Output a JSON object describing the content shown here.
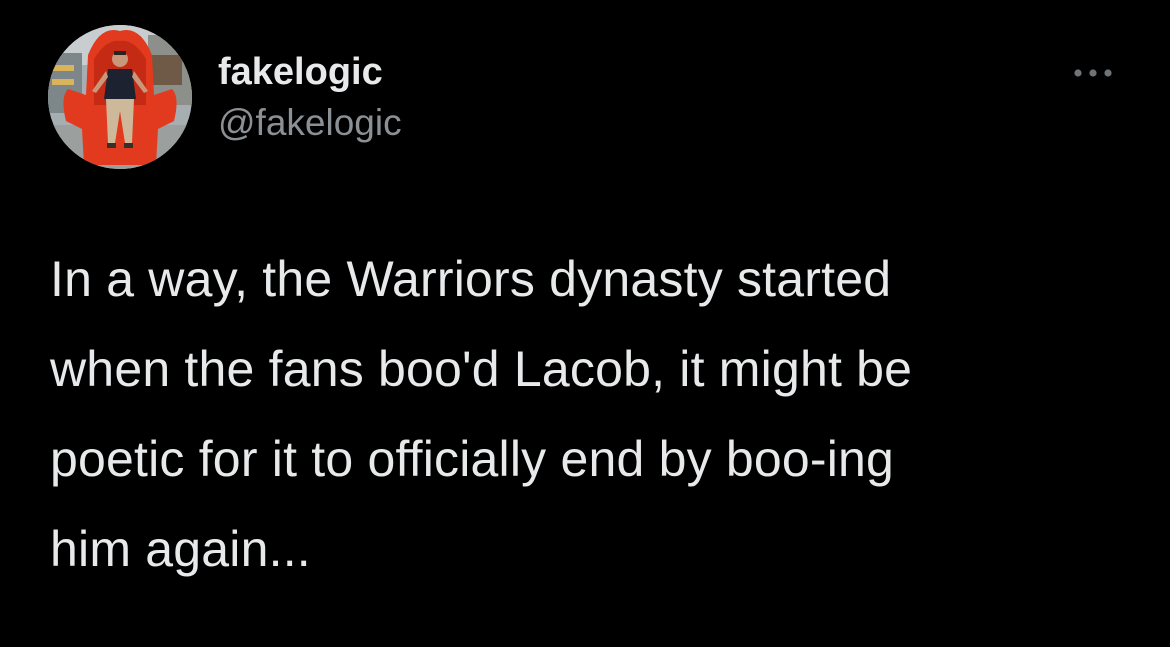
{
  "tweet": {
    "author": {
      "display_name": "fakelogic",
      "handle": "@fakelogic"
    },
    "more_icon": "more-horizontal-icon",
    "text": "In a way, the Warriors dynasty started\nwhen the fans boo'd Lacob, it might be\npoetic for it to officially end by boo-ing\nhim again..."
  },
  "colors": {
    "background": "#000000",
    "primary_text": "#e7e9ea",
    "secondary_text": "#8b9095"
  }
}
